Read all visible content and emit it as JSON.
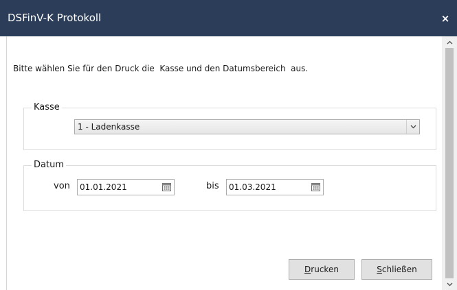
{
  "window": {
    "title": "DSFinV-K Protokoll",
    "close_glyph": "×"
  },
  "instruction": "Bitte wählen Sie für den Druck die  Kasse und den Datumsbereich  aus.",
  "kasse": {
    "legend": "Kasse",
    "selected": "1 - Ladenkasse",
    "dropdown_icon": "chevron-down-icon"
  },
  "datum": {
    "legend": "Datum",
    "from_label": "von",
    "from_value": "01.01.2021",
    "to_label": "bis",
    "to_value": "01.03.2021",
    "calendar_icon": "calendar-icon"
  },
  "buttons": {
    "print_accel": "D",
    "print_rest": "rucken",
    "close_accel": "S",
    "close_rest": "chließen"
  },
  "colors": {
    "titlebar": "#2b3d58",
    "button_face": "#e1e1e1",
    "scrollbar_track": "#f0f0f0",
    "scrollbar_thumb": "#c1c1c1"
  }
}
